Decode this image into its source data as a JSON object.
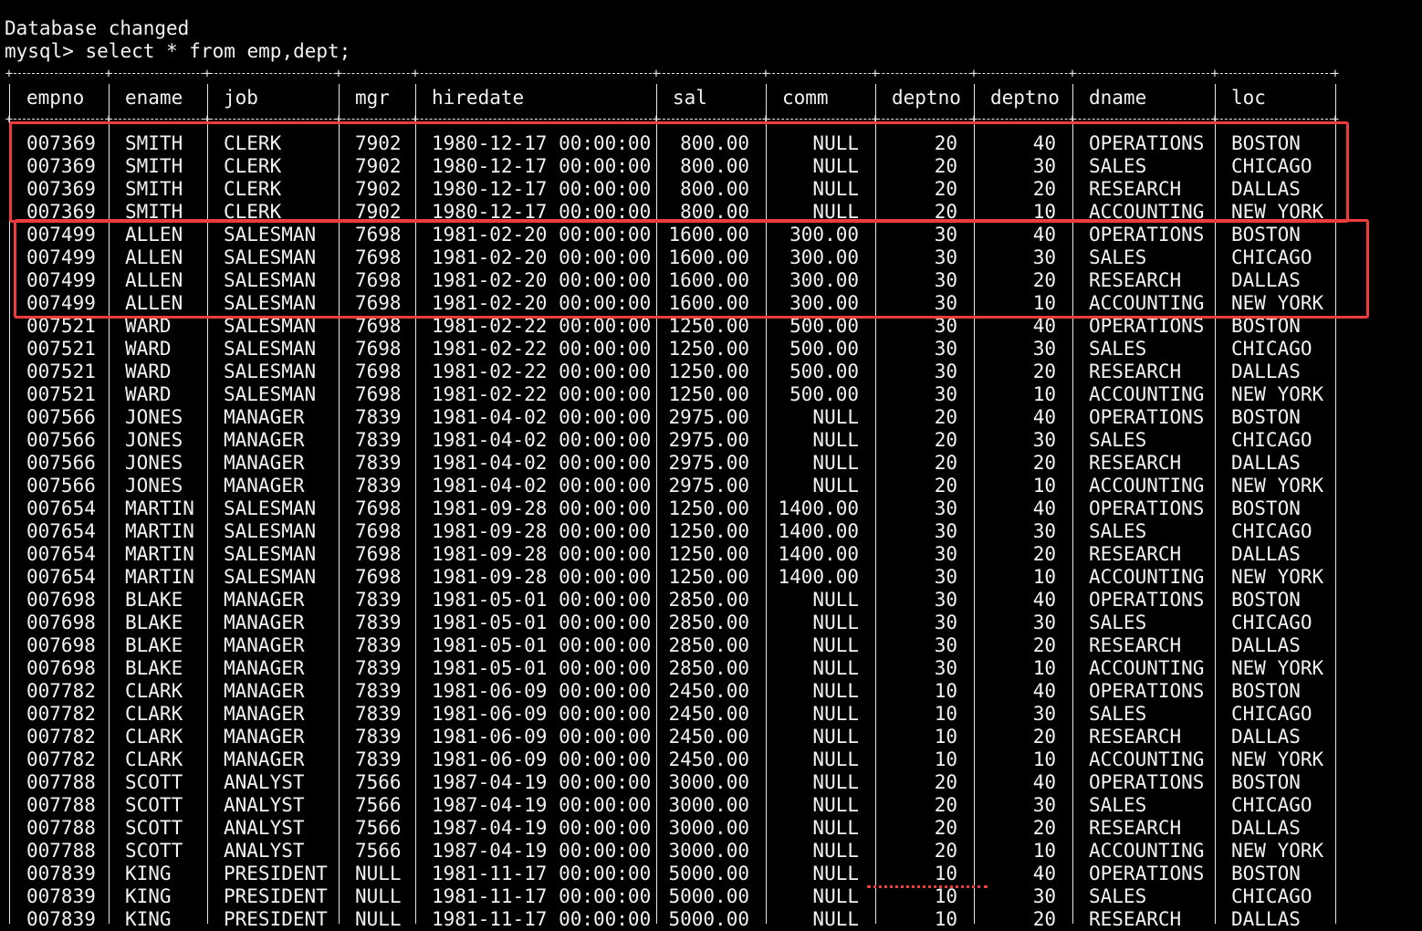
{
  "console": {
    "line1": "Database changed",
    "prompt": "mysql>",
    "command": "select * from emp,dept;"
  },
  "columns": [
    "empno",
    "ename",
    "job",
    "mgr",
    "hiredate",
    "sal",
    "comm",
    "deptno",
    "deptno",
    "dname",
    "loc"
  ],
  "rows": [
    [
      "007369",
      "SMITH",
      "CLERK",
      "7902",
      "1980-12-17 00:00:00",
      "800.00",
      "NULL",
      "20",
      "40",
      "OPERATIONS",
      "BOSTON"
    ],
    [
      "007369",
      "SMITH",
      "CLERK",
      "7902",
      "1980-12-17 00:00:00",
      "800.00",
      "NULL",
      "20",
      "30",
      "SALES",
      "CHICAGO"
    ],
    [
      "007369",
      "SMITH",
      "CLERK",
      "7902",
      "1980-12-17 00:00:00",
      "800.00",
      "NULL",
      "20",
      "20",
      "RESEARCH",
      "DALLAS"
    ],
    [
      "007369",
      "SMITH",
      "CLERK",
      "7902",
      "1980-12-17 00:00:00",
      "800.00",
      "NULL",
      "20",
      "10",
      "ACCOUNTING",
      "NEW YORK"
    ],
    [
      "007499",
      "ALLEN",
      "SALESMAN",
      "7698",
      "1981-02-20 00:00:00",
      "1600.00",
      "300.00",
      "30",
      "40",
      "OPERATIONS",
      "BOSTON"
    ],
    [
      "007499",
      "ALLEN",
      "SALESMAN",
      "7698",
      "1981-02-20 00:00:00",
      "1600.00",
      "300.00",
      "30",
      "30",
      "SALES",
      "CHICAGO"
    ],
    [
      "007499",
      "ALLEN",
      "SALESMAN",
      "7698",
      "1981-02-20 00:00:00",
      "1600.00",
      "300.00",
      "30",
      "20",
      "RESEARCH",
      "DALLAS"
    ],
    [
      "007499",
      "ALLEN",
      "SALESMAN",
      "7698",
      "1981-02-20 00:00:00",
      "1600.00",
      "300.00",
      "30",
      "10",
      "ACCOUNTING",
      "NEW YORK"
    ],
    [
      "007521",
      "WARD",
      "SALESMAN",
      "7698",
      "1981-02-22 00:00:00",
      "1250.00",
      "500.00",
      "30",
      "40",
      "OPERATIONS",
      "BOSTON"
    ],
    [
      "007521",
      "WARD",
      "SALESMAN",
      "7698",
      "1981-02-22 00:00:00",
      "1250.00",
      "500.00",
      "30",
      "30",
      "SALES",
      "CHICAGO"
    ],
    [
      "007521",
      "WARD",
      "SALESMAN",
      "7698",
      "1981-02-22 00:00:00",
      "1250.00",
      "500.00",
      "30",
      "20",
      "RESEARCH",
      "DALLAS"
    ],
    [
      "007521",
      "WARD",
      "SALESMAN",
      "7698",
      "1981-02-22 00:00:00",
      "1250.00",
      "500.00",
      "30",
      "10",
      "ACCOUNTING",
      "NEW YORK"
    ],
    [
      "007566",
      "JONES",
      "MANAGER",
      "7839",
      "1981-04-02 00:00:00",
      "2975.00",
      "NULL",
      "20",
      "40",
      "OPERATIONS",
      "BOSTON"
    ],
    [
      "007566",
      "JONES",
      "MANAGER",
      "7839",
      "1981-04-02 00:00:00",
      "2975.00",
      "NULL",
      "20",
      "30",
      "SALES",
      "CHICAGO"
    ],
    [
      "007566",
      "JONES",
      "MANAGER",
      "7839",
      "1981-04-02 00:00:00",
      "2975.00",
      "NULL",
      "20",
      "20",
      "RESEARCH",
      "DALLAS"
    ],
    [
      "007566",
      "JONES",
      "MANAGER",
      "7839",
      "1981-04-02 00:00:00",
      "2975.00",
      "NULL",
      "20",
      "10",
      "ACCOUNTING",
      "NEW YORK"
    ],
    [
      "007654",
      "MARTIN",
      "SALESMAN",
      "7698",
      "1981-09-28 00:00:00",
      "1250.00",
      "1400.00",
      "30",
      "40",
      "OPERATIONS",
      "BOSTON"
    ],
    [
      "007654",
      "MARTIN",
      "SALESMAN",
      "7698",
      "1981-09-28 00:00:00",
      "1250.00",
      "1400.00",
      "30",
      "30",
      "SALES",
      "CHICAGO"
    ],
    [
      "007654",
      "MARTIN",
      "SALESMAN",
      "7698",
      "1981-09-28 00:00:00",
      "1250.00",
      "1400.00",
      "30",
      "20",
      "RESEARCH",
      "DALLAS"
    ],
    [
      "007654",
      "MARTIN",
      "SALESMAN",
      "7698",
      "1981-09-28 00:00:00",
      "1250.00",
      "1400.00",
      "30",
      "10",
      "ACCOUNTING",
      "NEW YORK"
    ],
    [
      "007698",
      "BLAKE",
      "MANAGER",
      "7839",
      "1981-05-01 00:00:00",
      "2850.00",
      "NULL",
      "30",
      "40",
      "OPERATIONS",
      "BOSTON"
    ],
    [
      "007698",
      "BLAKE",
      "MANAGER",
      "7839",
      "1981-05-01 00:00:00",
      "2850.00",
      "NULL",
      "30",
      "30",
      "SALES",
      "CHICAGO"
    ],
    [
      "007698",
      "BLAKE",
      "MANAGER",
      "7839",
      "1981-05-01 00:00:00",
      "2850.00",
      "NULL",
      "30",
      "20",
      "RESEARCH",
      "DALLAS"
    ],
    [
      "007698",
      "BLAKE",
      "MANAGER",
      "7839",
      "1981-05-01 00:00:00",
      "2850.00",
      "NULL",
      "30",
      "10",
      "ACCOUNTING",
      "NEW YORK"
    ],
    [
      "007782",
      "CLARK",
      "MANAGER",
      "7839",
      "1981-06-09 00:00:00",
      "2450.00",
      "NULL",
      "10",
      "40",
      "OPERATIONS",
      "BOSTON"
    ],
    [
      "007782",
      "CLARK",
      "MANAGER",
      "7839",
      "1981-06-09 00:00:00",
      "2450.00",
      "NULL",
      "10",
      "30",
      "SALES",
      "CHICAGO"
    ],
    [
      "007782",
      "CLARK",
      "MANAGER",
      "7839",
      "1981-06-09 00:00:00",
      "2450.00",
      "NULL",
      "10",
      "20",
      "RESEARCH",
      "DALLAS"
    ],
    [
      "007782",
      "CLARK",
      "MANAGER",
      "7839",
      "1981-06-09 00:00:00",
      "2450.00",
      "NULL",
      "10",
      "10",
      "ACCOUNTING",
      "NEW YORK"
    ],
    [
      "007788",
      "SCOTT",
      "ANALYST",
      "7566",
      "1987-04-19 00:00:00",
      "3000.00",
      "NULL",
      "20",
      "40",
      "OPERATIONS",
      "BOSTON"
    ],
    [
      "007788",
      "SCOTT",
      "ANALYST",
      "7566",
      "1987-04-19 00:00:00",
      "3000.00",
      "NULL",
      "20",
      "30",
      "SALES",
      "CHICAGO"
    ],
    [
      "007788",
      "SCOTT",
      "ANALYST",
      "7566",
      "1987-04-19 00:00:00",
      "3000.00",
      "NULL",
      "20",
      "20",
      "RESEARCH",
      "DALLAS"
    ],
    [
      "007788",
      "SCOTT",
      "ANALYST",
      "7566",
      "1987-04-19 00:00:00",
      "3000.00",
      "NULL",
      "20",
      "10",
      "ACCOUNTING",
      "NEW YORK"
    ],
    [
      "007839",
      "KING",
      "PRESIDENT",
      "NULL",
      "1981-11-17 00:00:00",
      "5000.00",
      "NULL",
      "10",
      "40",
      "OPERATIONS",
      "BOSTON"
    ],
    [
      "007839",
      "KING",
      "PRESIDENT",
      "NULL",
      "1981-11-17 00:00:00",
      "5000.00",
      "NULL",
      "10",
      "30",
      "SALES",
      "CHICAGO"
    ],
    [
      "007839",
      "KING",
      "PRESIDENT",
      "NULL",
      "1981-11-17 00:00:00",
      "5000.00",
      "NULL",
      "10",
      "20",
      "RESEARCH",
      "DALLAS"
    ]
  ],
  "annotation_color": "#ee3b3b"
}
